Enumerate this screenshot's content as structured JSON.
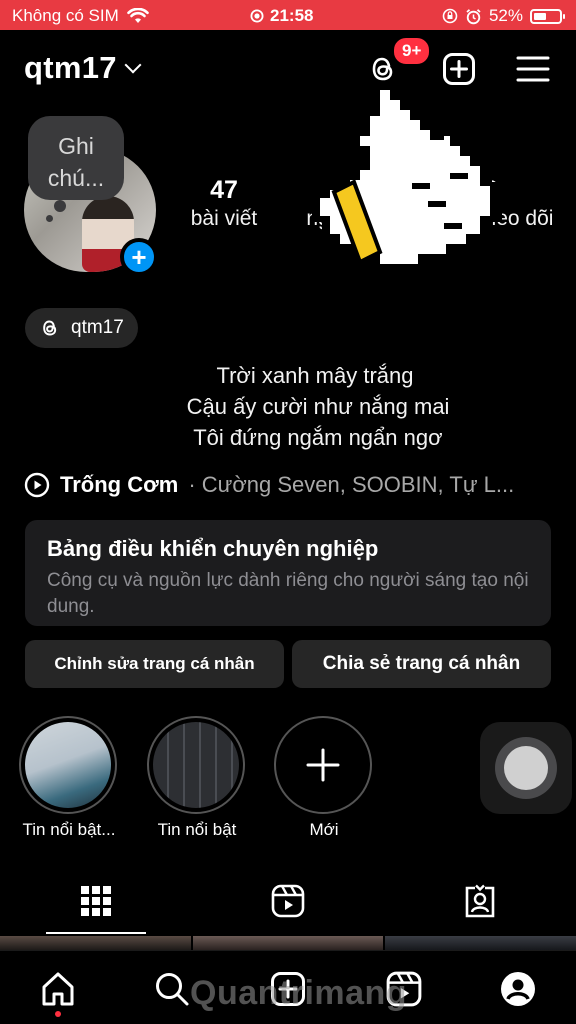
{
  "status_bar": {
    "carrier": "Không có SIM",
    "time": "21:58",
    "battery": "52%",
    "background_color": "#e83a42"
  },
  "header": {
    "username": "qtm17",
    "notification_badge": "9+",
    "icons": [
      "threads-icon",
      "create-post-icon",
      "menu-icon"
    ]
  },
  "profile": {
    "note": "Ghi chú...",
    "stats": {
      "posts": {
        "count": "47",
        "label": "bài viết"
      },
      "followers": {
        "count": "",
        "label": "ng"
      },
      "following": {
        "count": "3",
        "label": "heo dõi"
      }
    },
    "threads_handle": "qtm17",
    "bio": [
      "Trời xanh mây trắng",
      " Cậu ấy cười như nắng mai",
      " Tôi đứng ngắm ngẩn ngơ"
    ],
    "music": {
      "song": "Trống Cơm",
      "artist": "· Cường Seven, SOOBIN, Tự L..."
    }
  },
  "professional_dashboard": {
    "title": "Bảng điều khiển chuyên nghiệp",
    "subtitle": "Công cụ và nguồn lực dành riêng cho người sáng tạo nội dung."
  },
  "actions": {
    "edit_label": "Chỉnh sửa trang cá nhân",
    "share_label": "Chia sẻ trang cá nhân"
  },
  "highlights": [
    {
      "label": "Tin nổi bật..."
    },
    {
      "label": "Tin nổi bật"
    },
    {
      "label": "Mới"
    }
  ],
  "tabs": [
    "posts-grid-icon",
    "reels-icon",
    "tagged-icon"
  ],
  "bottom_nav": [
    "home-icon",
    "search-icon",
    "create-icon",
    "reels-icon",
    "profile-icon"
  ],
  "watermark": "Quantrimang",
  "accent_color": "#0095f6",
  "badge_color": "#ff3040"
}
